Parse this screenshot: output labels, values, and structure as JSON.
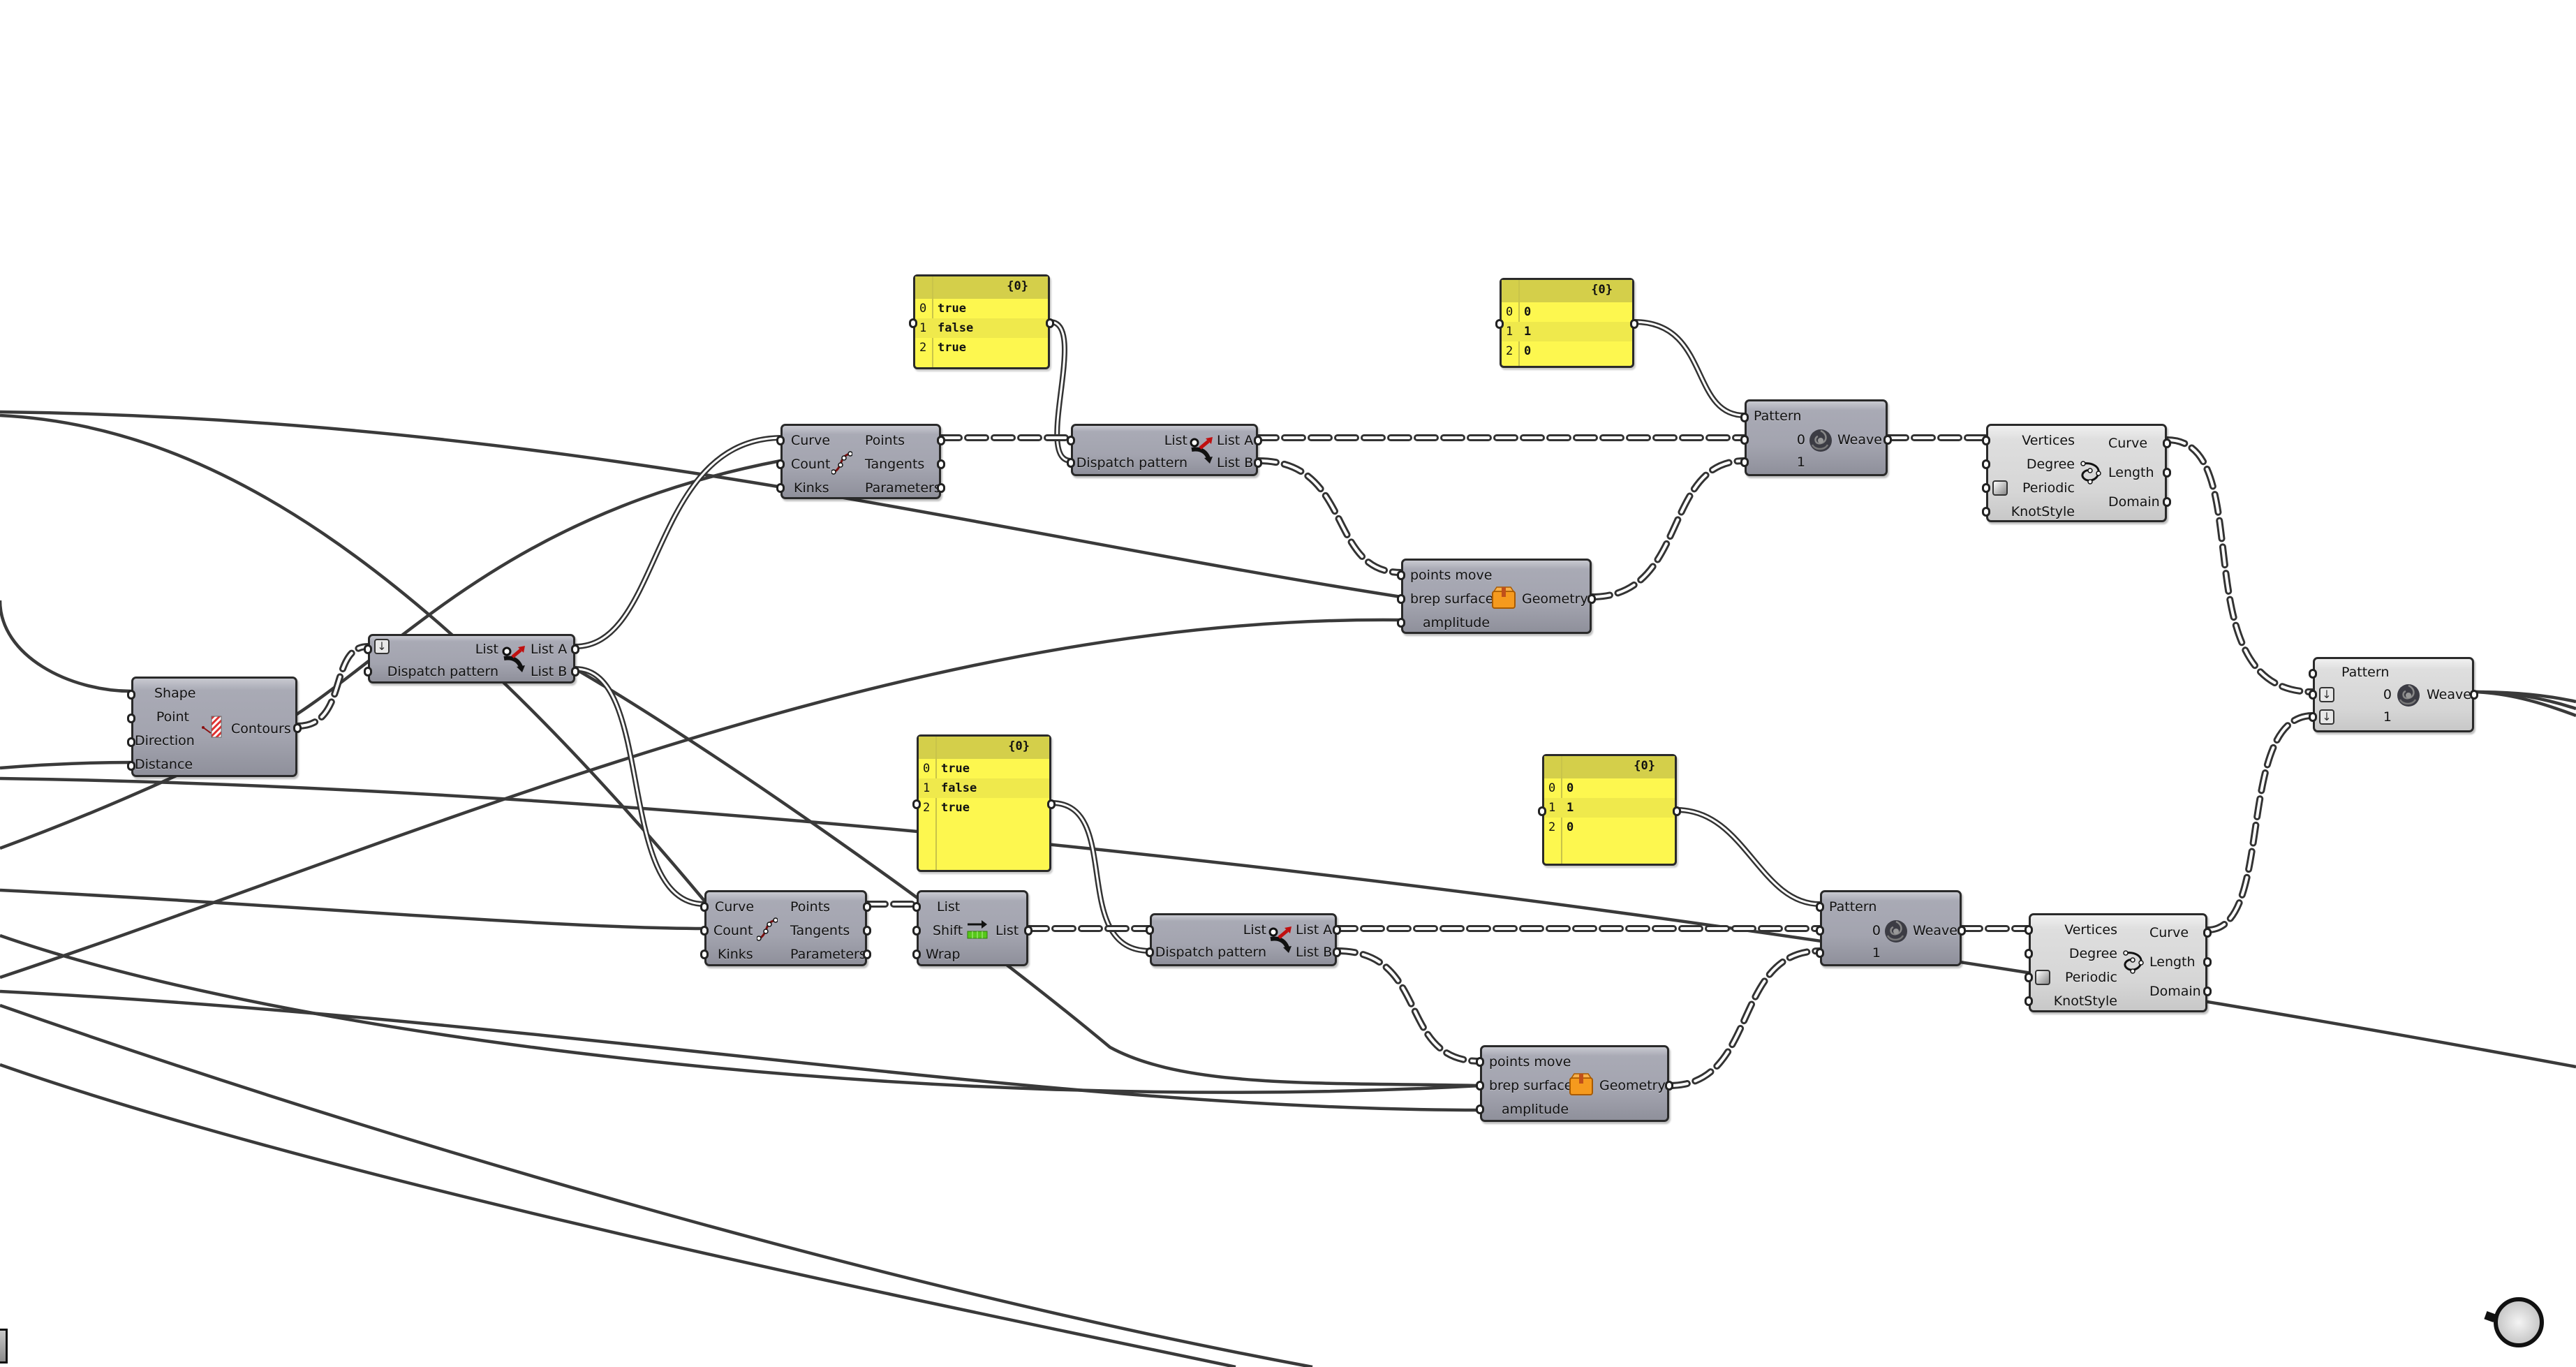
{
  "app": "Grasshopper canvas",
  "components": {
    "contours": {
      "inputs": [
        "Shape",
        "Point",
        "Direction",
        "Distance"
      ],
      "outputs": [
        "Contours"
      ],
      "icon": "contour-icon"
    },
    "dispatch_top_left": {
      "inputs": [
        "List",
        "Dispatch pattern"
      ],
      "outputs": [
        "List A",
        "List B"
      ],
      "icon": "dispatch-icon"
    },
    "divide_curve_top": {
      "inputs": [
        "Curve",
        "Count",
        "Kinks"
      ],
      "outputs": [
        "Points",
        "Tangents",
        "Parameters"
      ],
      "icon": "divide-curve-icon"
    },
    "panel_bool_top": {
      "header": "{0}",
      "rows": [
        {
          "index": "0",
          "value": "true"
        },
        {
          "index": "1",
          "value": "false"
        },
        {
          "index": "2",
          "value": "true"
        }
      ]
    },
    "dispatch_top": {
      "inputs": [
        "List",
        "Dispatch pattern"
      ],
      "outputs": [
        "List A",
        "List B"
      ],
      "icon": "dispatch-icon"
    },
    "points_move_top": {
      "inputs": [
        "points move",
        "brep surface",
        "amplitude"
      ],
      "outputs": [
        "Geometry"
      ],
      "icon": "cluster-box-icon"
    },
    "panel_int_top": {
      "header": "{0}",
      "rows": [
        {
          "index": "0",
          "value": "0"
        },
        {
          "index": "1",
          "value": "1"
        },
        {
          "index": "2",
          "value": "0"
        }
      ]
    },
    "weave_top": {
      "inputs": [
        "Pattern",
        "0",
        "1"
      ],
      "outputs": [
        "Weave"
      ],
      "icon": "weave-icon"
    },
    "interpolate_top": {
      "inputs": [
        "Vertices",
        "Degree",
        "Periodic",
        "KnotStyle"
      ],
      "outputs": [
        "Curve",
        "Length",
        "Domain"
      ],
      "icon": "interpolate-icon"
    },
    "weave_final": {
      "inputs": [
        "Pattern",
        "0",
        "1"
      ],
      "outputs": [
        "Weave"
      ],
      "icon": "weave-icon"
    },
    "panel_bool_bottom": {
      "header": "{0}",
      "rows": [
        {
          "index": "0",
          "value": "true"
        },
        {
          "index": "1",
          "value": "false"
        },
        {
          "index": "2",
          "value": "true"
        }
      ]
    },
    "divide_curve_bottom": {
      "inputs": [
        "Curve",
        "Count",
        "Kinks"
      ],
      "outputs": [
        "Points",
        "Tangents",
        "Parameters"
      ],
      "icon": "divide-curve-icon"
    },
    "shift_list": {
      "inputs": [
        "List",
        "Shift",
        "Wrap"
      ],
      "outputs": [
        "List"
      ],
      "icon": "shift-list-icon"
    },
    "dispatch_bottom": {
      "inputs": [
        "List",
        "Dispatch pattern"
      ],
      "outputs": [
        "List A",
        "List B"
      ],
      "icon": "dispatch-icon"
    },
    "panel_int_bottom": {
      "header": "{0}",
      "rows": [
        {
          "index": "0",
          "value": "0"
        },
        {
          "index": "1",
          "value": "1"
        },
        {
          "index": "2",
          "value": "0"
        }
      ]
    },
    "weave_bottom": {
      "inputs": [
        "Pattern",
        "0",
        "1"
      ],
      "outputs": [
        "Weave"
      ],
      "icon": "weave-icon"
    },
    "points_move_bottom": {
      "inputs": [
        "points move",
        "brep surface",
        "amplitude"
      ],
      "outputs": [
        "Geometry"
      ],
      "icon": "cluster-box-icon"
    },
    "interpolate_bottom": {
      "inputs": [
        "Vertices",
        "Degree",
        "Periodic",
        "KnotStyle"
      ],
      "outputs": [
        "Curve",
        "Length",
        "Domain"
      ],
      "icon": "interpolate-icon"
    }
  },
  "colors": {
    "canvas": "#ffffff",
    "component": "#a3a4af",
    "component_light": "#d9d9d9",
    "panel": "#fdf74f",
    "panel_header": "#d4cf4a",
    "wire": "#3a3a3a"
  }
}
